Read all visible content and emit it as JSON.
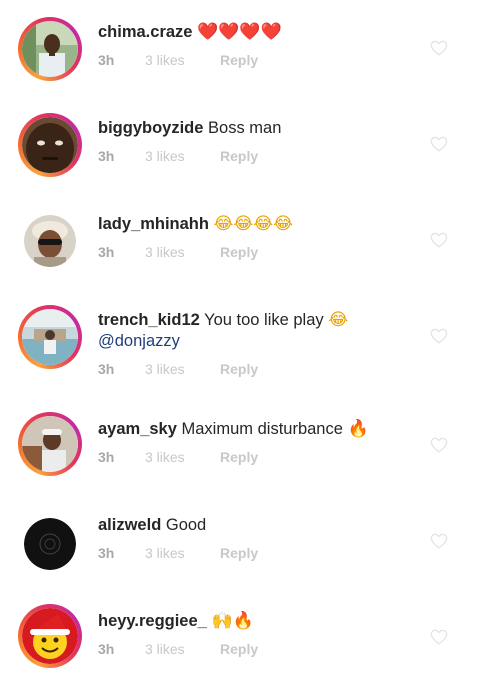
{
  "comments": [
    {
      "username": "chima.craze",
      "text": "",
      "emoji": "❤️❤️❤️❤️",
      "time": "3h",
      "likes": "3 likes",
      "reply": "Reply",
      "avatar": "avatar-man-outdoors",
      "ring": true
    },
    {
      "username": "biggyboyzide",
      "text": "Boss man",
      "emoji": "",
      "time": "3h",
      "likes": "3 likes",
      "reply": "Reply",
      "avatar": "avatar-face-closeup",
      "ring": true
    },
    {
      "username": "lady_mhinahh",
      "text": "",
      "emoji": "😂😂😂😂",
      "time": "3h",
      "likes": "3 likes",
      "reply": "Reply",
      "avatar": "avatar-woman-sunglasses",
      "ring": false
    },
    {
      "username": "trench_kid12",
      "text": "You too like play",
      "emoji": "😂",
      "mention": "@donjazzy",
      "time": "3h",
      "likes": "3 likes",
      "reply": "Reply",
      "avatar": "avatar-poolside",
      "ring": true
    },
    {
      "username": "ayam_sky",
      "text": "Maximum disturbance",
      "emoji": "🔥",
      "time": "3h",
      "likes": "3 likes",
      "reply": "Reply",
      "avatar": "avatar-man-cap",
      "ring": true
    },
    {
      "username": "alizweld",
      "text": "Good",
      "emoji": "",
      "time": "3h",
      "likes": "3 likes",
      "reply": "Reply",
      "avatar": "avatar-black-logo",
      "ring": false
    },
    {
      "username": "heyy.reggiee_",
      "text": "",
      "emoji": "🙌🔥",
      "time": "3h",
      "likes": "3 likes",
      "reply": "Reply",
      "avatar": "avatar-santa-emoji",
      "ring": true
    }
  ],
  "icons": {
    "like": "heart-outline-icon"
  },
  "colors": {
    "username": "#262626",
    "meta": "#c8c8c8",
    "mention": "#1f3f7a",
    "ring_start": "#f9a13a",
    "ring_end": "#c32aa3"
  }
}
